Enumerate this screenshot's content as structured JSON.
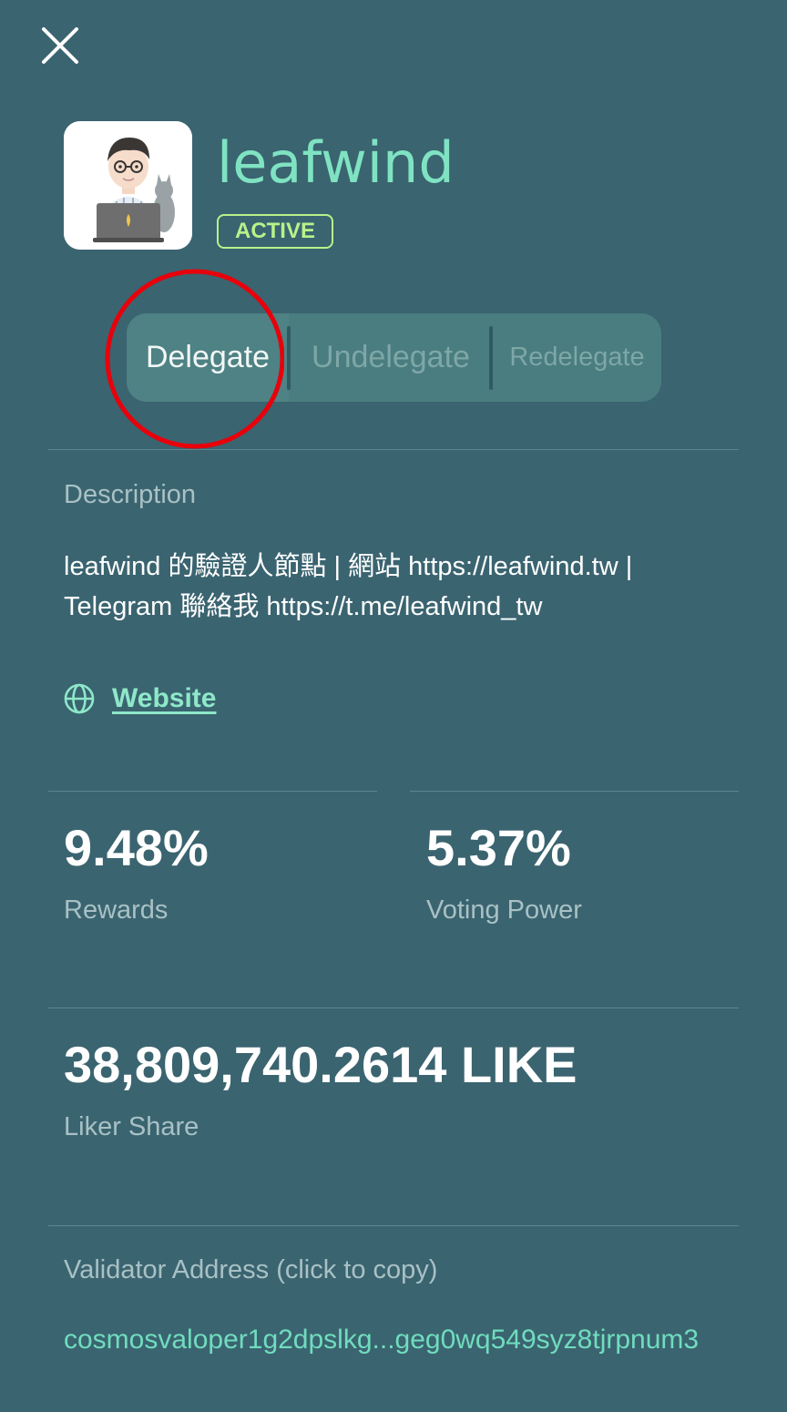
{
  "validator": {
    "name": "leafwind",
    "status": "ACTIVE"
  },
  "actions": {
    "delegate": "Delegate",
    "undelegate": "Undelegate",
    "redelegate": "Redelegate"
  },
  "description": {
    "label": "Description",
    "text": "leafwind 的驗證人節點 | 網站 https://leafwind.tw | Telegram 聯絡我 https://t.me/leafwind_tw",
    "website_label": "Website"
  },
  "stats": {
    "rewards_value": "9.48%",
    "rewards_label": "Rewards",
    "voting_power_value": "5.37%",
    "voting_power_label": "Voting Power",
    "liker_share_value": "38,809,740.2614 LIKE",
    "liker_share_label": "Liker Share"
  },
  "address": {
    "label": "Validator Address (click to copy)",
    "value": "cosmosvaloper1g2dpslkg...geg0wq549syz8tjrpnum3"
  },
  "icons": {
    "close": "close-icon",
    "globe": "globe-icon",
    "avatar": "avatar-illustration"
  },
  "colors": {
    "background": "#3a6470",
    "accent": "#7fe3c2",
    "active_badge": "#b9f28a",
    "annotation": "#e8000b"
  }
}
